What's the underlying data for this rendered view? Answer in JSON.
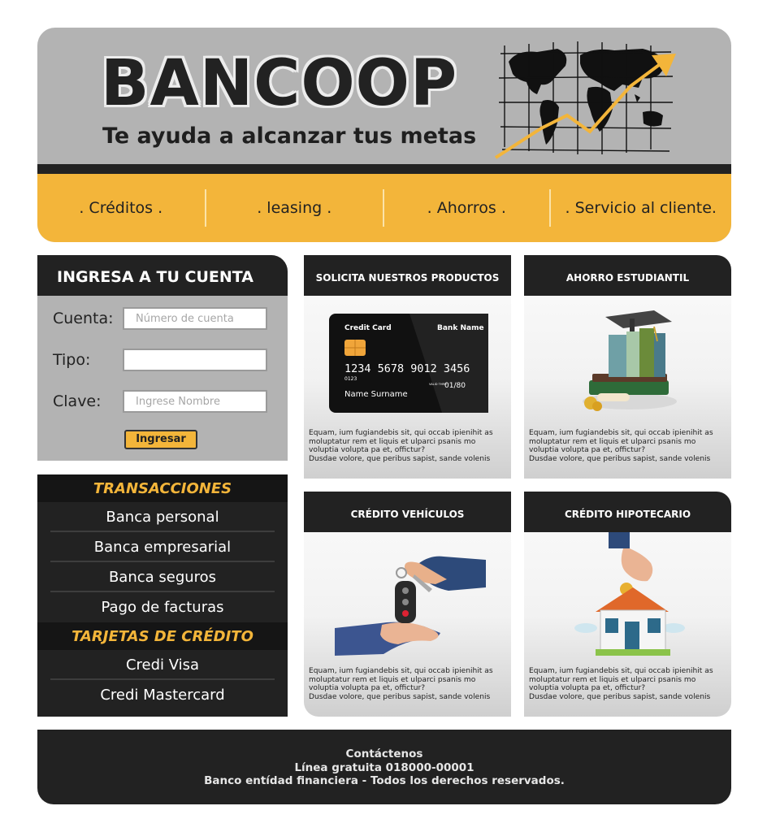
{
  "header": {
    "logo": "BANCOOP",
    "tagline": "Te ayuda a alcanzar tus metas"
  },
  "nav": [
    ". Créditos .",
    ". leasing .",
    ". Ahorros .",
    ". Servicio al cliente."
  ],
  "login": {
    "title": "INGRESA A TU CUENTA",
    "fields": [
      {
        "label": "Cuenta:",
        "placeholder": "Número de cuenta"
      },
      {
        "label": "Tipo:",
        "placeholder": ""
      },
      {
        "label": "Clave:",
        "placeholder": "Ingrese Nombre"
      }
    ],
    "button": "Ingresar"
  },
  "menu": {
    "transacciones_title": "TRANSACCIONES",
    "transacciones": [
      "Banca personal",
      "Banca empresarial",
      "Banca seguros",
      "Pago de facturas"
    ],
    "tarjetas_title": "TARJETAS DE CRÉDITO",
    "tarjetas": [
      "Credi Visa",
      "Credi Mastercard"
    ]
  },
  "cards": [
    {
      "title": "SOLICITA NUESTROS PRODUCTOS",
      "text": "Equam, ium fugiandebis sit, qui occab ipienihit as moluptatur rem et liquis et ulparci psanis mo voluptia volupta pa et, offictur?\nDusdae volore, que peribus sapist, sande volenis"
    },
    {
      "title": "AHORRO ESTUDIANTIL",
      "text": "Equam, ium fugiandebis sit, qui occab ipienihit as moluptatur rem et liquis et ulparci psanis mo voluptia volupta pa et, offictur?\nDusdae volore, que peribus sapist, sande volenis"
    },
    {
      "title": "CRÉDITO VEHÍCULOS",
      "text": "Equam, ium fugiandebis sit, qui occab ipienihit as moluptatur rem et liquis et ulparci psanis mo voluptia volupta pa et, offictur?\nDusdae volore, que peribus sapist, sande volenis"
    },
    {
      "title": "CRÉDITO HIPOTECARIO",
      "text": "Equam, ium fugiandebis sit, qui occab ipienihit as moluptatur rem et liquis et ulparci psanis mo voluptia volupta pa et, offictur?\nDusdae volore, que peribus sapist, sande volenis"
    }
  ],
  "credit_card": {
    "label": "Credit Card",
    "bank": "Bank Name",
    "number": "1234  5678  9012  3456",
    "small": "0123",
    "valid": "VALID THRU",
    "expiry": "01/80",
    "name": "Name Surname"
  },
  "footer": {
    "line1": "Contáctenos",
    "line2": "Línea gratuita 018000-00001",
    "line3": "Banco entídad financiera -  Todos los derechos reservados."
  },
  "colors": {
    "accent": "#f3b53a",
    "dark": "#222222",
    "gray": "#b3b3b3"
  }
}
